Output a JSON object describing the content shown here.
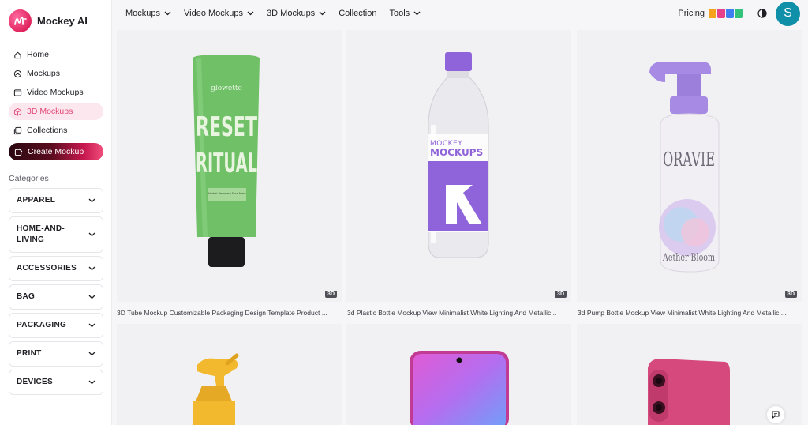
{
  "brand": {
    "name": "Mockey AI"
  },
  "sidebar": {
    "nav": [
      {
        "label": "Home",
        "icon": "home-icon"
      },
      {
        "label": "Mockups",
        "icon": "mockups-icon"
      },
      {
        "label": "Video Mockups",
        "icon": "video-icon"
      },
      {
        "label": "3D Mockups",
        "icon": "cube-icon",
        "active": true
      },
      {
        "label": "Collections",
        "icon": "collections-icon"
      }
    ],
    "create_label": "Create Mockup",
    "categories_title": "Categories",
    "categories": [
      "APPAREL",
      "HOME-AND-LIVING",
      "ACCESSORIES",
      "BAG",
      "PACKAGING",
      "PRINT",
      "DEVICES"
    ]
  },
  "topnav": {
    "items": [
      {
        "label": "Mockups",
        "has_dropdown": true
      },
      {
        "label": "Video Mockups",
        "has_dropdown": true
      },
      {
        "label": "3D Mockups",
        "has_dropdown": true
      },
      {
        "label": "Collection",
        "has_dropdown": false
      },
      {
        "label": "Tools",
        "has_dropdown": true
      }
    ],
    "pricing_label": "Pricing",
    "avatar_initial": "S"
  },
  "cards": [
    {
      "badge": "3D",
      "caption": "3D Tube Mockup Customizable Packaging Design Template Product ...",
      "product_lines": [
        "glowette",
        "RESET",
        "RITUAL",
        "Herbal Recovery Face Mask"
      ]
    },
    {
      "badge": "3D",
      "caption": "3d Plastic Bottle Mockup View Minimalist White Lighting And Metallic...",
      "product_lines": [
        "MOCKEY",
        "MOCKUPS"
      ]
    },
    {
      "badge": "3D",
      "caption": "3d Pump Bottle Mockup View Minimalist White Lighting And Metallic ...",
      "product_lines": [
        "ORAVIE",
        "Aether Bloom"
      ]
    },
    {
      "badge": "",
      "caption": ""
    },
    {
      "badge": "",
      "caption": ""
    },
    {
      "badge": "",
      "caption": ""
    }
  ],
  "colors": {
    "accent": "#e14775",
    "active_bg": "#fde7ef",
    "avatar": "#0f8fa8",
    "tube_green": "#6fc066",
    "purple": "#8f63d9"
  }
}
